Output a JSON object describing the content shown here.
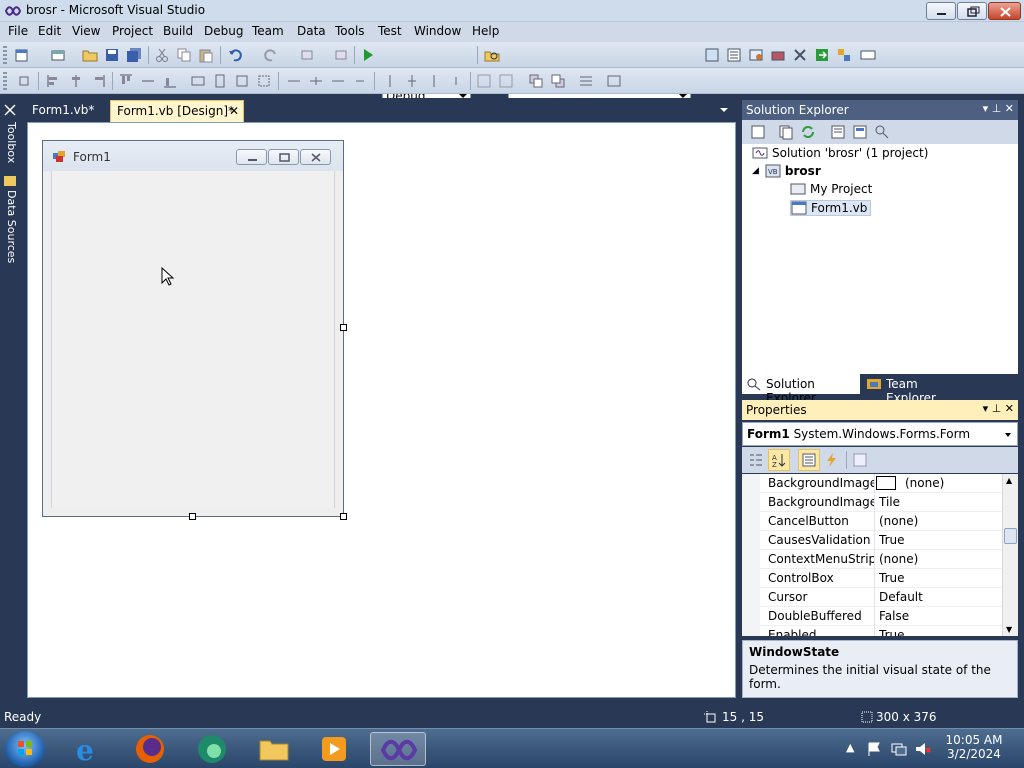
{
  "window": {
    "title": "brosr - Microsoft Visual Studio"
  },
  "menu": [
    "File",
    "Edit",
    "View",
    "Project",
    "Build",
    "Debug",
    "Team",
    "Data",
    "Tools",
    "Test",
    "Window",
    "Help"
  ],
  "toolbar": {
    "config_value": "Debug",
    "platform_value": ""
  },
  "side_tabs": [
    "Toolbox",
    "Data Sources"
  ],
  "doc_tabs": [
    {
      "label": "Form1.vb*",
      "active": false
    },
    {
      "label": "Form1.vb [Design]*",
      "active": true
    }
  ],
  "designer": {
    "form_title": "Form1"
  },
  "solution_explorer": {
    "title": "Solution Explorer",
    "tree": [
      {
        "label": "Solution 'brosr' (1 project)",
        "bold": false
      },
      {
        "label": "brosr",
        "bold": true
      },
      {
        "label": "My Project",
        "bold": false
      },
      {
        "label": "Form1.vb",
        "bold": false
      }
    ],
    "tabs": [
      "Solution Explorer",
      "Team Explorer"
    ]
  },
  "properties": {
    "title": "Properties",
    "selected_object": "Form1",
    "selected_type": "System.Windows.Forms.Form",
    "rows": [
      {
        "name": "BackgroundImage",
        "value": "(none)"
      },
      {
        "name": "BackgroundImageLayout",
        "value": "Tile"
      },
      {
        "name": "CancelButton",
        "value": "(none)"
      },
      {
        "name": "CausesValidation",
        "value": "True"
      },
      {
        "name": "ContextMenuStrip",
        "value": "(none)"
      },
      {
        "name": "ControlBox",
        "value": "True"
      },
      {
        "name": "Cursor",
        "value": "Default"
      },
      {
        "name": "DoubleBuffered",
        "value": "False"
      },
      {
        "name": "Enabled",
        "value": "True"
      }
    ],
    "description": {
      "title": "WindowState",
      "text": "Determines the initial visual state of the form."
    }
  },
  "status": {
    "text": "Ready",
    "position": "15 , 15",
    "size": "300 x 376"
  },
  "clock": {
    "time": "10:05 AM",
    "date": "3/2/2024"
  }
}
